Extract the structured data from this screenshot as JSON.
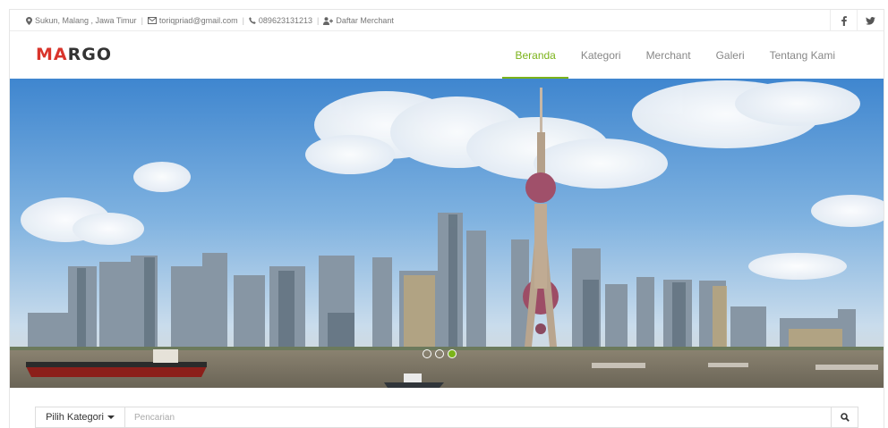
{
  "topbar": {
    "address": "Sukun, Malang , Jawa Timur",
    "email": "toriqpriad@gmail.com",
    "phone": "089623131213",
    "merchant_link": "Daftar Merchant",
    "social": [
      {
        "icon": "facebook-icon",
        "glyph": "f"
      },
      {
        "icon": "twitter-icon",
        "glyph": "🐦"
      }
    ]
  },
  "brand": {
    "logo_accent": "MA",
    "logo_rest": "RGO",
    "accent_color": "#d9342b"
  },
  "nav": {
    "items": [
      {
        "label": "Beranda",
        "active": true
      },
      {
        "label": "Kategori",
        "active": false
      },
      {
        "label": "Merchant",
        "active": false
      },
      {
        "label": "Galeri",
        "active": false
      },
      {
        "label": "Tentang Kami",
        "active": false
      }
    ],
    "active_color": "#7bb31a"
  },
  "slider": {
    "slide_count": 3,
    "active_index": 2
  },
  "search": {
    "category_label": "Pilih Kategori",
    "placeholder": "Pencarian"
  }
}
